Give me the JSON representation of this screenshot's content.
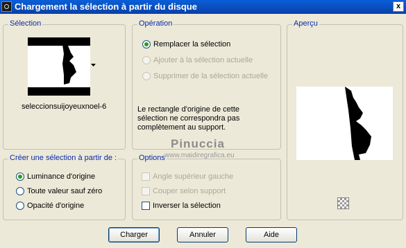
{
  "window": {
    "title": "Chargement la sélection à partir du disque",
    "close_glyph": "x"
  },
  "selection_panel": {
    "legend": "Sélection",
    "file_name": "seleccionsuijoyeuxnoel-6"
  },
  "operation_panel": {
    "legend": "Opération",
    "options": [
      {
        "label": "Remplacer la sélection",
        "checked": true,
        "enabled": true
      },
      {
        "label": "Ajouter à la sélection actuelle",
        "checked": false,
        "enabled": false
      },
      {
        "label": "Supprimer de la sélection actuelle",
        "checked": false,
        "enabled": false
      }
    ],
    "message": [
      "Le rectangle d'origine de cette",
      "sélection ne correspondra pas",
      "complètement au support."
    ]
  },
  "preview_panel": {
    "legend": "Aperçu"
  },
  "create_panel": {
    "legend": "Créer une sélection à partir de :",
    "options": [
      {
        "label": "Luminance d'origine",
        "checked": true
      },
      {
        "label": "Toute valeur sauf zéro",
        "checked": false
      },
      {
        "label": "Opacité d'origine",
        "checked": false
      }
    ]
  },
  "options_panel": {
    "legend": "Options",
    "checkboxes": [
      {
        "label": "Angle supérieur gauche",
        "checked": false,
        "enabled": false
      },
      {
        "label": "Couper selon support",
        "checked": false,
        "enabled": false
      },
      {
        "label": "Inverser la sélection",
        "checked": false,
        "enabled": true
      }
    ]
  },
  "watermark": {
    "line1": "Pinuccia",
    "line2": "www.maidiregrafica.eu"
  },
  "buttons": {
    "load": "Charger",
    "cancel": "Annuler",
    "help": "Aide"
  },
  "icons": {
    "app": "app-icon",
    "dropdown": "dropdown-arrow-icon",
    "preview_toggle": "checker-icon"
  }
}
